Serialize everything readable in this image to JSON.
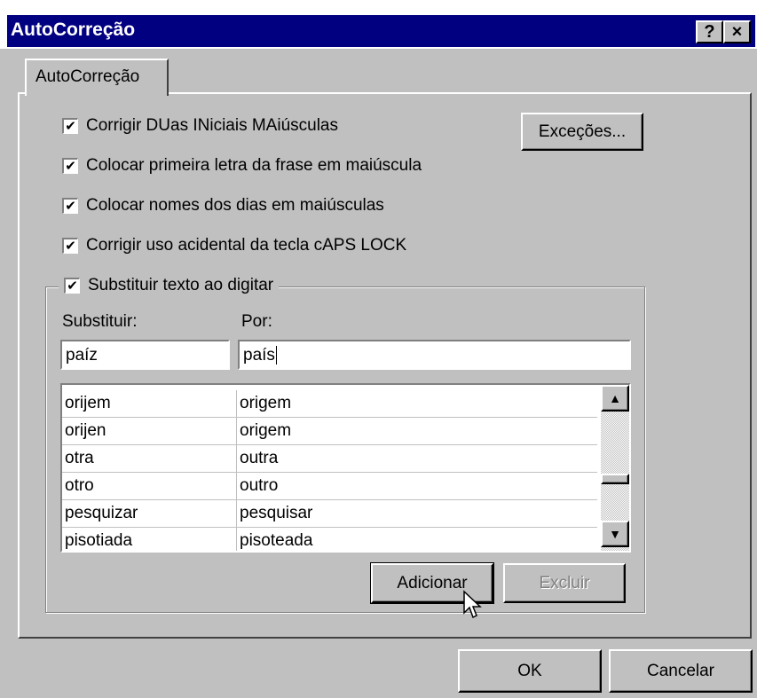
{
  "window": {
    "title": "AutoCorreção",
    "help_button": "?",
    "close_button": "×"
  },
  "tab": {
    "label": "AutoCorreção"
  },
  "options": [
    {
      "checked": true,
      "label": "Corrigir DUas INiciais MAiúsculas"
    },
    {
      "checked": true,
      "label": "Colocar primeira letra da frase em maiúscula"
    },
    {
      "checked": true,
      "label": "Colocar nomes dos dias em maiúsculas"
    },
    {
      "checked": true,
      "label": "Corrigir uso acidental da tecla cAPS LOCK"
    }
  ],
  "exceptions_button": "Exceções...",
  "replace_group": {
    "checked": true,
    "label": "Substituir texto ao digitar",
    "replace_label": "Substituir:",
    "with_label": "Por:",
    "replace_value": "paíz",
    "with_value": "país",
    "rows": [
      {
        "from": "orijem",
        "to": "origem"
      },
      {
        "from": "orijen",
        "to": "origem"
      },
      {
        "from": "otra",
        "to": "outra"
      },
      {
        "from": "otro",
        "to": "outro"
      },
      {
        "from": "pesquizar",
        "to": "pesquisar"
      },
      {
        "from": "pisotiada",
        "to": "pisoteada"
      }
    ],
    "add_button": "Adicionar",
    "delete_button": "Excluir"
  },
  "footer": {
    "ok_button": "OK",
    "cancel_button": "Cancelar"
  }
}
